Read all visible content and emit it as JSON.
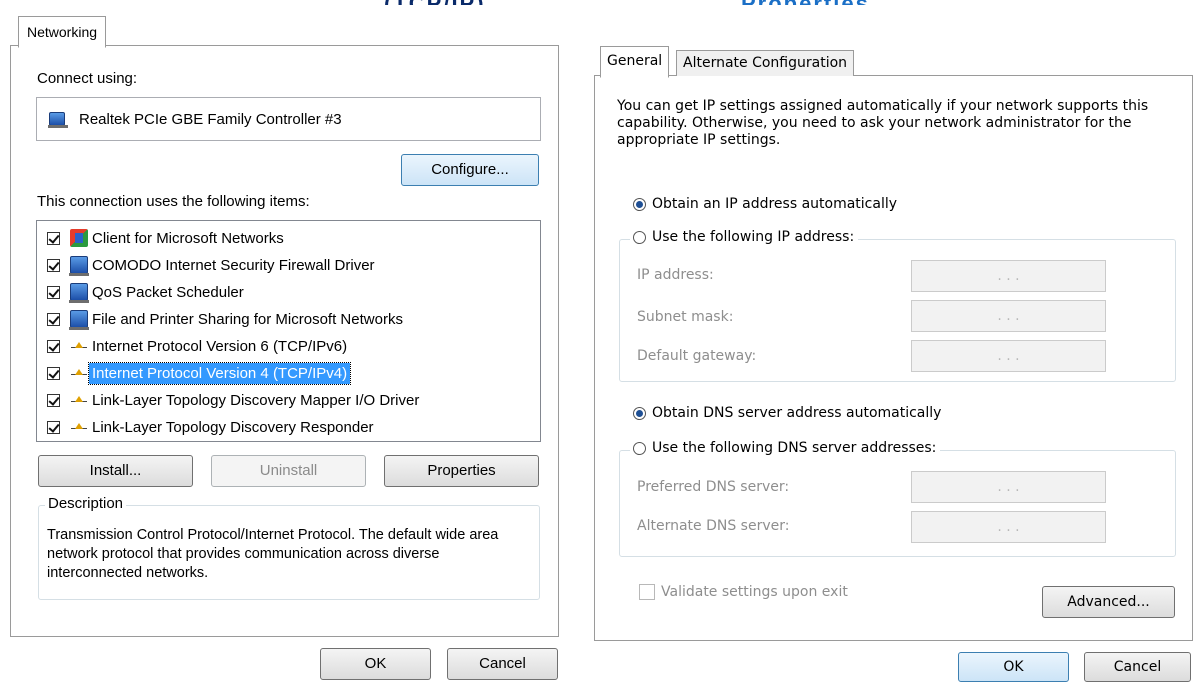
{
  "left": {
    "tab": "Networking",
    "connect_using_label": "Connect using:",
    "adapter_name": "Realtek PCIe GBE Family Controller #3",
    "configure_button": "Configure...",
    "items_label": "This connection uses the following items:",
    "items": [
      {
        "label": "Client for Microsoft Networks",
        "icon": "client-icon",
        "checked": true
      },
      {
        "label": "COMODO Internet Security Firewall Driver",
        "icon": "network-service-icon",
        "checked": true
      },
      {
        "label": "QoS Packet Scheduler",
        "icon": "network-service-icon",
        "checked": true
      },
      {
        "label": "File and Printer Sharing for Microsoft Networks",
        "icon": "network-service-icon",
        "checked": true
      },
      {
        "label": "Internet Protocol Version 6 (TCP/IPv6)",
        "icon": "protocol-icon",
        "checked": true
      },
      {
        "label": "Internet Protocol Version 4 (TCP/IPv4)",
        "icon": "protocol-icon",
        "checked": true,
        "selected": true
      },
      {
        "label": "Link-Layer Topology Discovery Mapper I/O Driver",
        "icon": "protocol-icon",
        "checked": true
      },
      {
        "label": "Link-Layer Topology Discovery Responder",
        "icon": "protocol-icon",
        "checked": true
      }
    ],
    "install_button": "Install...",
    "uninstall_button": "Uninstall",
    "properties_button": "Properties",
    "description_legend": "Description",
    "description_text": "Transmission Control Protocol/Internet Protocol. The default wide area network protocol that provides communication across diverse interconnected networks.",
    "ok_button": "OK",
    "cancel_button": "Cancel"
  },
  "right": {
    "tabs": [
      "General",
      "Alternate Configuration"
    ],
    "intro": "You can get IP settings assigned automatically if your network supports this capability. Otherwise, you need to ask your network administrator for the appropriate IP settings.",
    "ip_auto": "Obtain an IP address automatically",
    "ip_manual": "Use the following IP address:",
    "ip_address_label": "IP address:",
    "subnet_label": "Subnet mask:",
    "gateway_label": "Default gateway:",
    "dns_auto": "Obtain DNS server address automatically",
    "dns_manual": "Use the following DNS server addresses:",
    "preferred_dns_label": "Preferred DNS server:",
    "alternate_dns_label": "Alternate DNS server:",
    "ip_placeholder": ".   .   .",
    "validate_label": "Validate settings upon exit",
    "advanced_button": "Advanced...",
    "ok_button": "OK",
    "cancel_button": "Cancel"
  },
  "colors": {
    "selection": "#3399ff",
    "radio_dot": "#1e4f94",
    "focus_border": "#3c7fb1"
  }
}
